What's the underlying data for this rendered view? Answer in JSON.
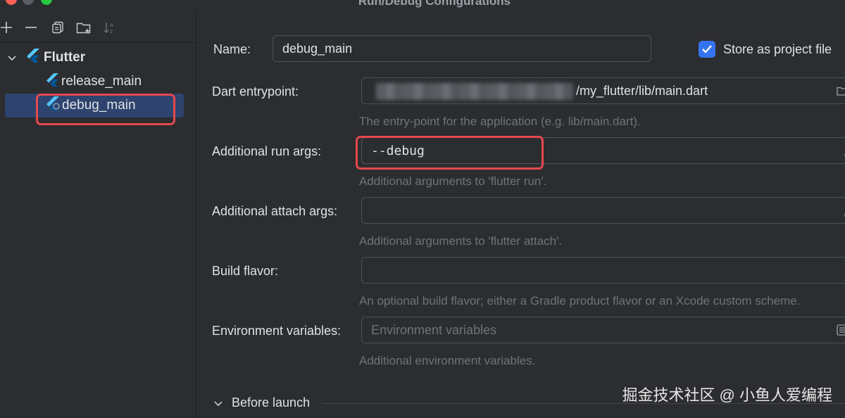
{
  "window": {
    "title": "Run/Debug Configurations"
  },
  "tree": {
    "group_label": "Flutter",
    "items": [
      {
        "label": "release_main"
      },
      {
        "label": "debug_main"
      }
    ]
  },
  "form": {
    "name_label": "Name:",
    "name_value": "debug_main",
    "store_label": "Store as project file",
    "store_checked": true,
    "entrypoint_label": "Dart entrypoint:",
    "entrypoint_value": "/my_flutter/lib/main.dart",
    "entrypoint_hint": "The entry-point for the application (e.g. lib/main.dart).",
    "run_args_label": "Additional run args:",
    "run_args_value": "--debug",
    "run_args_hint": "Additional arguments to 'flutter run'.",
    "attach_args_label": "Additional attach args:",
    "attach_args_value": "",
    "attach_args_hint": "Additional arguments to 'flutter attach'.",
    "flavor_label": "Build flavor:",
    "flavor_value": "",
    "flavor_hint": "An optional build flavor; either a Gradle product flavor or an Xcode custom scheme.",
    "env_label": "Environment variables:",
    "env_placeholder": "Environment variables",
    "env_hint": "Additional environment variables.",
    "before_launch_label": "Before launch"
  },
  "watermark": "掘金技术社区 @ 小鱼人爱编程",
  "colors": {
    "accent": "#3574f0",
    "highlight_border": "#e5484d",
    "selection": "#2e436e"
  }
}
